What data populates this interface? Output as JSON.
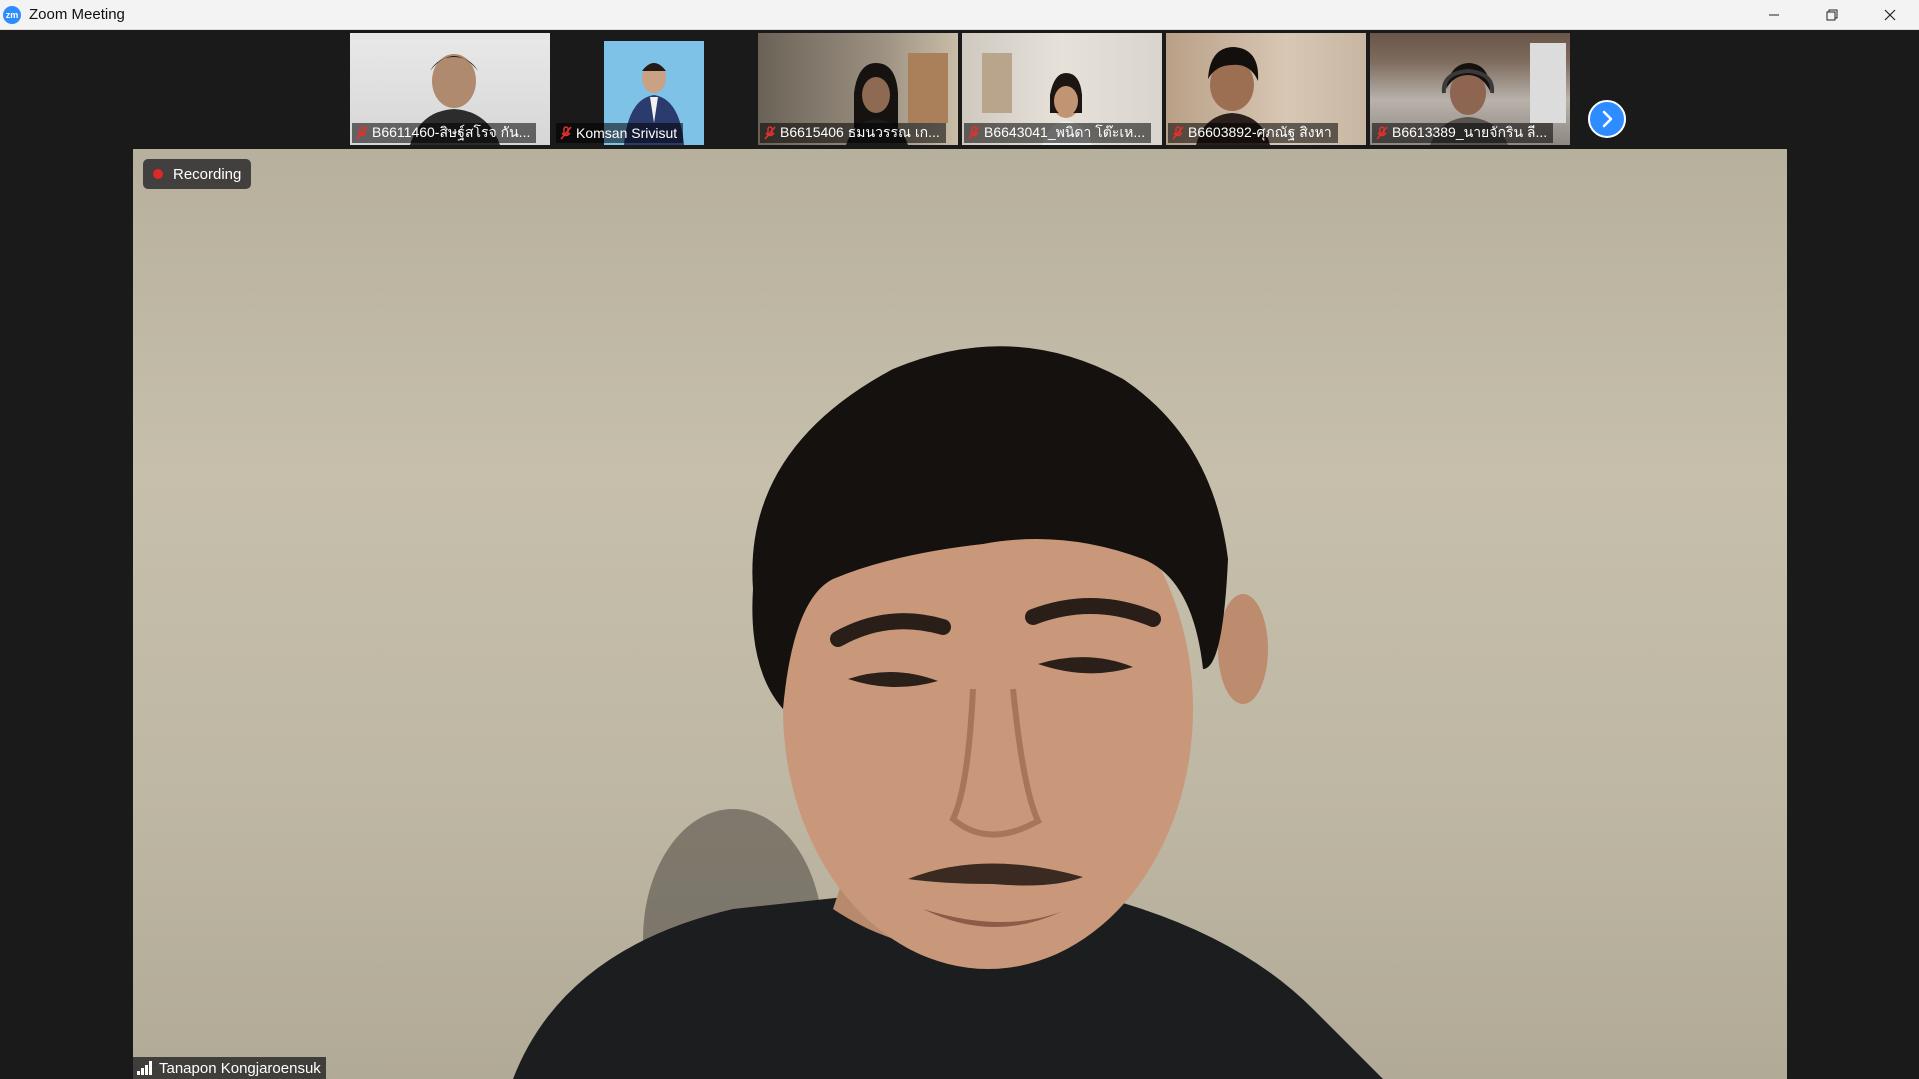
{
  "window": {
    "title": "Zoom Meeting",
    "app_icon_text": "zm"
  },
  "gallery": {
    "participants": [
      {
        "name": "B6611460-สิษฐ์สโรจ กัน...",
        "muted": true,
        "mic_icon": "mic-muted-icon"
      },
      {
        "name": "Komsan Srivisut",
        "muted": true,
        "mic_icon": "mic-muted-icon"
      },
      {
        "name": "B6615406 ธมนวรรณ เก...",
        "muted": true,
        "mic_icon": "mic-muted-icon"
      },
      {
        "name": "B6643041_พนิดา โต๊ะเห...",
        "muted": true,
        "mic_icon": "mic-muted-icon"
      },
      {
        "name": "B6603892-ศุภณัฐ สิงหา",
        "muted": true,
        "mic_icon": "mic-muted-icon"
      },
      {
        "name": "B6613389_นายจักริน ลี...",
        "muted": true,
        "mic_icon": "mic-muted-icon"
      }
    ],
    "next_page_icon": "chevron-right-icon"
  },
  "main": {
    "recording_label": "Recording",
    "speaker_name": "Tanapon Kongjaroensuk",
    "signal_icon": "signal-bars-icon"
  },
  "colors": {
    "accent": "#2d8cff",
    "recording_dot": "#e02828",
    "muted_mic": "#e0312f",
    "background": "#1a1a1a"
  }
}
